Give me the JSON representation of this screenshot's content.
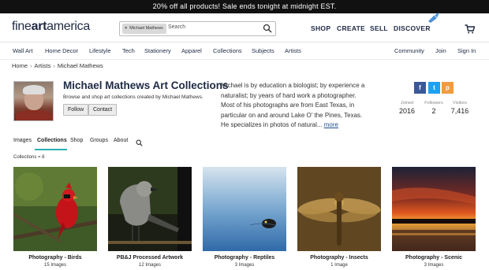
{
  "promo": {
    "text": "20% off all products!   Sale ends tonight at midnight EST."
  },
  "logo": {
    "part1": "fine",
    "part2": "art",
    "part3": "america"
  },
  "search": {
    "chip": "Michael Mathews",
    "placeholder": "Search"
  },
  "topnav": {
    "shop": "SHOP",
    "create": "CREATE",
    "sell": "SELL",
    "discover": "DISCOVER"
  },
  "catnav": {
    "left": [
      "Wall Art",
      "Home Decor",
      "Lifestyle",
      "Tech",
      "Stationery",
      "Apparel",
      "Collections",
      "Subjects",
      "Artists"
    ],
    "right": [
      "Community",
      "Join",
      "Sign In"
    ]
  },
  "breadcrumb": [
    "Home",
    "Artists",
    "Michael Mathews"
  ],
  "profile": {
    "title": "Michael Mathews Art Collections",
    "subtitle": "Browse and shop art collections created by Michael Mathews.",
    "follow": "Follow",
    "contact": "Contact",
    "bio": "Michael is by education a biologist; by experience a naturalist; by years of hard work a photographer.  Most of his photographs are from East Texas, in particular on and around Lake O' the Pines, Texas.  He specializes in photos of natural...",
    "more": "more"
  },
  "share": {
    "facebook": "f",
    "twitter": "t",
    "pinterest": "p"
  },
  "stats": [
    {
      "label": "Joined",
      "value": "2016"
    },
    {
      "label": "Followers",
      "value": "2"
    },
    {
      "label": "Visitors",
      "value": "7,416"
    }
  ],
  "tabs": [
    "Images",
    "Collections",
    "Shop",
    "Groups",
    "About"
  ],
  "collections_count": "Collections = 8",
  "collections": [
    {
      "title": "Photography - Birds",
      "count": "15 Images"
    },
    {
      "title": "PB&J Processed Artwork",
      "count": "12 Images"
    },
    {
      "title": "Photography - Reptiles",
      "count": "3 Images"
    },
    {
      "title": "Photography - Insects",
      "count": "1 Image"
    },
    {
      "title": "Photography - Scenic",
      "count": "3 Images"
    }
  ],
  "colors": {
    "brand": "#1e2a44",
    "accent": "#2bb0b0",
    "facebook": "#3b5998",
    "twitter": "#1da1f2",
    "pinterest": "#f29c3b"
  }
}
